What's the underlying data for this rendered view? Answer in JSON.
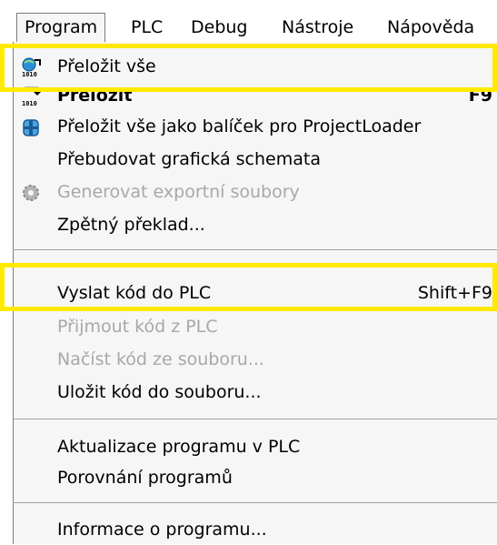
{
  "menubar": {
    "items": [
      {
        "label": "Program"
      },
      {
        "label": "PLC"
      },
      {
        "label": "Debug"
      },
      {
        "label": "Nástroje"
      },
      {
        "label": "Nápověda"
      }
    ]
  },
  "menu": {
    "items": [
      {
        "label": "Přeložit vše",
        "icon": "compile-all-icon"
      },
      {
        "label": "Přeložit",
        "shortcut": "F9",
        "icon": "compile-icon"
      },
      {
        "label": "Přeložit vše jako balíček pro ProjectLoader",
        "icon": "package-icon"
      },
      {
        "label": "Přebudovat grafická schemata"
      },
      {
        "label": "Generovat exportní soubory",
        "icon": "gear-icon"
      },
      {
        "label": "Zpětný překlad..."
      },
      {
        "label": "Vyslat kód do PLC",
        "shortcut": "Shift+F9"
      },
      {
        "label": "Přijmout kód z PLC"
      },
      {
        "label": "Načíst kód ze souboru..."
      },
      {
        "label": "Uložit kód do souboru..."
      },
      {
        "label": "Aktualizace programu v PLC"
      },
      {
        "label": "Porovnání programů"
      },
      {
        "label": "Informace o programu..."
      }
    ]
  },
  "colors": {
    "highlight": "#ffea00",
    "disabled_text": "#a8a8a8",
    "menu_bg": "#f6f6f6"
  }
}
